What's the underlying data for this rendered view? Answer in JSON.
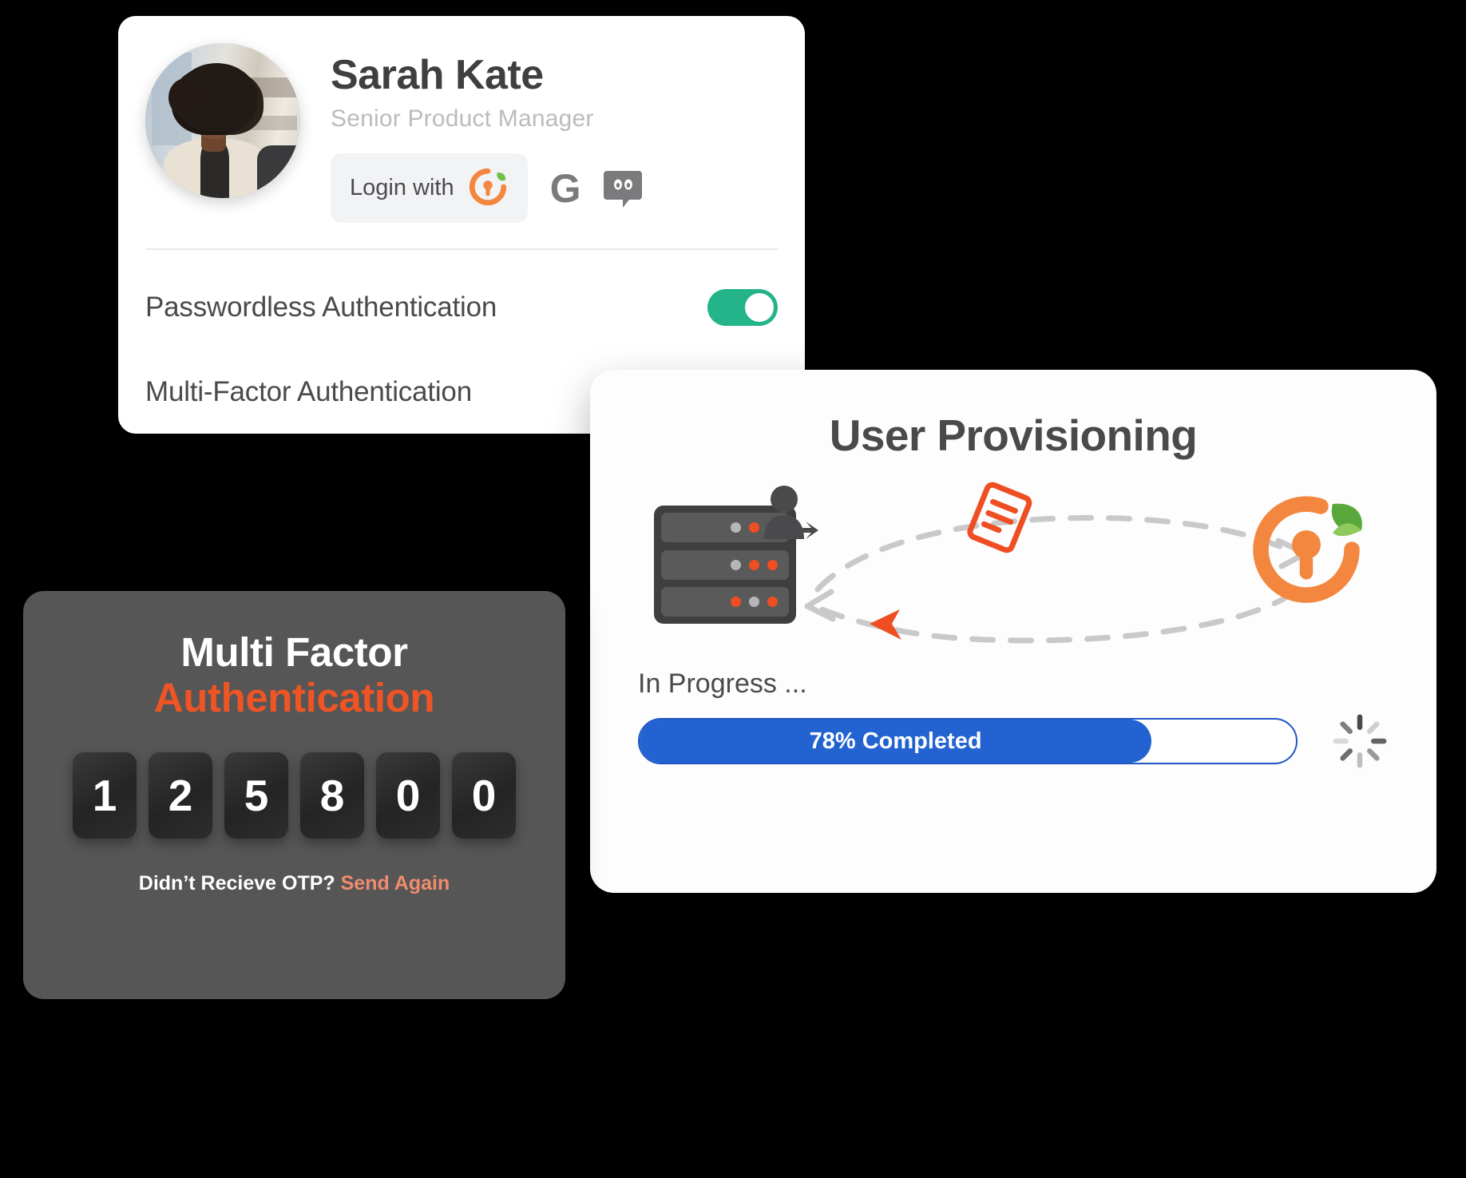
{
  "profile": {
    "name": "Sarah Kate",
    "role": "Senior Product Manager",
    "avatar_icon": "user-photo",
    "login_button_label": "Login with",
    "login_button_icon": "brand-lock-leaf-logo",
    "social": [
      {
        "name": "google",
        "icon": "google-g-icon",
        "glyph": "G"
      },
      {
        "name": "discord",
        "icon": "discord-icon",
        "glyph": ""
      }
    ],
    "settings": [
      {
        "label": "Passwordless Authentication",
        "toggle": "on"
      },
      {
        "label": "Multi-Factor Authentication",
        "toggle": "on"
      }
    ]
  },
  "provisioning": {
    "title": "User Provisioning",
    "server_icon": "server-rack-icon",
    "flow_icons": [
      "user-transfer-icon",
      "document-icon",
      "brand-lock-leaf-logo"
    ],
    "status_label": "In Progress ...",
    "progress_percent": 78,
    "progress_label": "78% Completed",
    "spinner_icon": "loading-spinner-icon"
  },
  "mfa": {
    "title_line1": "Multi Factor",
    "title_line2": "Authentication",
    "otp_digits": [
      "1",
      "2",
      "5",
      "8",
      "0",
      "0"
    ],
    "footer_question": "Didn’t Recieve OTP?",
    "footer_action": "Send Again"
  },
  "colors": {
    "brand_orange": "#ef5425",
    "brand_orange_light": "#f4873f",
    "brand_green": "#6fbf4a",
    "toggle_green": "#23b48a",
    "progress_blue": "#2263d1",
    "send_again": "#f08c6e",
    "dark_card": "#565656"
  }
}
